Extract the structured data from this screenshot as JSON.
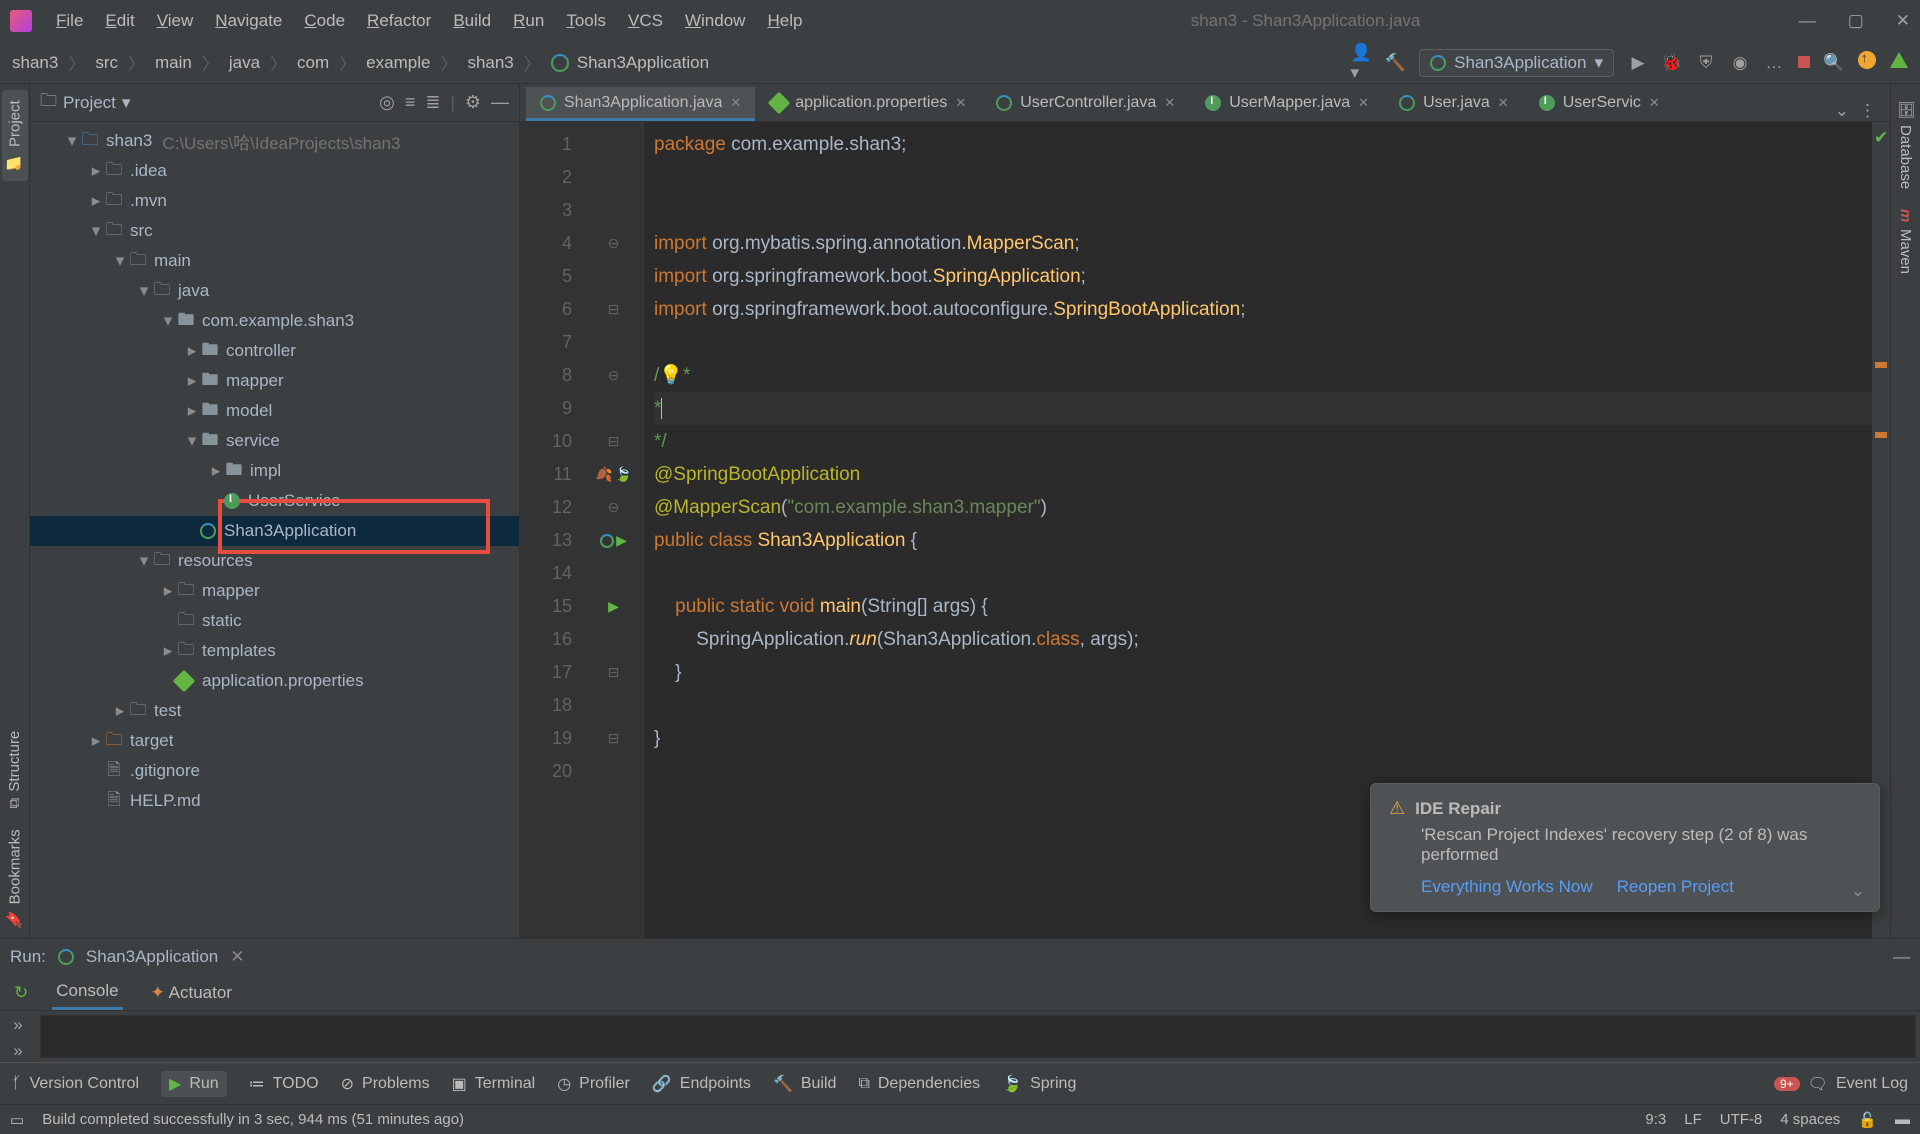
{
  "titlebar": {
    "menus": [
      "File",
      "Edit",
      "View",
      "Navigate",
      "Code",
      "Refactor",
      "Build",
      "Run",
      "Tools",
      "VCS",
      "Window",
      "Help"
    ],
    "title": "shan3 - Shan3Application.java"
  },
  "breadcrumb": [
    "shan3",
    "src",
    "main",
    "java",
    "com",
    "example",
    "shan3",
    "Shan3Application"
  ],
  "runconfig": "Shan3Application",
  "project": {
    "title": "Project",
    "root": {
      "name": "shan3",
      "path": "C:\\Users\\哈\\IdeaProjects\\shan3"
    },
    "tree": [
      {
        "d": 1,
        "arrow": "▾",
        "type": "module",
        "label": "shan3",
        "dim": "C:\\Users\\哈\\IdeaProjects\\shan3"
      },
      {
        "d": 2,
        "arrow": "▸",
        "type": "folder",
        "label": ".idea"
      },
      {
        "d": 2,
        "arrow": "▸",
        "type": "folder",
        "label": ".mvn"
      },
      {
        "d": 2,
        "arrow": "▾",
        "type": "folder",
        "label": "src"
      },
      {
        "d": 3,
        "arrow": "▾",
        "type": "folder",
        "label": "main"
      },
      {
        "d": 4,
        "arrow": "▾",
        "type": "folder-src",
        "label": "java"
      },
      {
        "d": 5,
        "arrow": "▾",
        "type": "pkg",
        "label": "com.example.shan3"
      },
      {
        "d": 6,
        "arrow": "▸",
        "type": "pkg",
        "label": "controller"
      },
      {
        "d": 6,
        "arrow": "▸",
        "type": "pkg",
        "label": "mapper"
      },
      {
        "d": 6,
        "arrow": "▸",
        "type": "pkg",
        "label": "model"
      },
      {
        "d": 6,
        "arrow": "▾",
        "type": "pkg",
        "label": "service"
      },
      {
        "d": 7,
        "arrow": "▸",
        "type": "pkg",
        "label": "impl"
      },
      {
        "d": 7,
        "arrow": "",
        "type": "interface",
        "label": "UserService",
        "strike": true
      },
      {
        "d": 6,
        "arrow": "",
        "type": "class",
        "label": "Shan3Application",
        "selected": true
      },
      {
        "d": 4,
        "arrow": "▾",
        "type": "folder-res",
        "label": "resources"
      },
      {
        "d": 5,
        "arrow": "▸",
        "type": "folder",
        "label": "mapper"
      },
      {
        "d": 5,
        "arrow": "",
        "type": "folder",
        "label": "static"
      },
      {
        "d": 5,
        "arrow": "▸",
        "type": "folder",
        "label": "templates"
      },
      {
        "d": 5,
        "arrow": "",
        "type": "prop",
        "label": "application.properties"
      },
      {
        "d": 3,
        "arrow": "▸",
        "type": "folder-test",
        "label": "test"
      },
      {
        "d": 2,
        "arrow": "▸",
        "type": "folder-orange",
        "label": "target"
      },
      {
        "d": 2,
        "arrow": "",
        "type": "file",
        "label": ".gitignore"
      },
      {
        "d": 2,
        "arrow": "",
        "type": "file-md",
        "label": "HELP.md"
      }
    ]
  },
  "tabs": [
    {
      "label": "Shan3Application.java",
      "kind": "class",
      "active": true
    },
    {
      "label": "application.properties",
      "kind": "prop"
    },
    {
      "label": "UserController.java",
      "kind": "class"
    },
    {
      "label": "UserMapper.java",
      "kind": "interface"
    },
    {
      "label": "User.java",
      "kind": "class"
    },
    {
      "label": "UserServic",
      "kind": "interface"
    }
  ],
  "code": {
    "lines": [
      {
        "n": 1,
        "tokens": [
          [
            "kw",
            "package "
          ],
          [
            "cls",
            "com.example.shan3"
          ],
          [
            "cls",
            ";"
          ]
        ]
      },
      {
        "n": 2,
        "tokens": []
      },
      {
        "n": 3,
        "tokens": []
      },
      {
        "n": 4,
        "tokens": [
          [
            "kw",
            "import "
          ],
          [
            "cls",
            "org.mybatis.spring.annotation."
          ],
          [
            "id",
            "MapperScan"
          ],
          [
            "cls",
            ";"
          ]
        ],
        "gut": "⊖"
      },
      {
        "n": 5,
        "tokens": [
          [
            "kw",
            "import "
          ],
          [
            "cls",
            "org.springframework.boot."
          ],
          [
            "id",
            "SpringApplication"
          ],
          [
            "cls",
            ";"
          ]
        ]
      },
      {
        "n": 6,
        "tokens": [
          [
            "kw",
            "import "
          ],
          [
            "cls",
            "org.springframework.boot.autoconfigure."
          ],
          [
            "id",
            "SpringBootApplication"
          ],
          [
            "cls",
            ";"
          ]
        ],
        "gut": "⊟"
      },
      {
        "n": 7,
        "tokens": []
      },
      {
        "n": 8,
        "tokens": [
          [
            "cmt",
            "/"
          ],
          [
            "bulb",
            "💡"
          ],
          [
            "cmt",
            "*"
          ]
        ],
        "gut": "⊖"
      },
      {
        "n": 9,
        "tokens": [
          [
            "cmt",
            "*"
          ],
          [
            "caret",
            ""
          ]
        ],
        "current": true
      },
      {
        "n": 10,
        "tokens": [
          [
            "cmt",
            "*/"
          ]
        ],
        "gut": "⊟"
      },
      {
        "n": 11,
        "tokens": [
          [
            "ann",
            "@SpringBootApplication"
          ]
        ],
        "gut": "⊖",
        "mark": "leaf"
      },
      {
        "n": 12,
        "tokens": [
          [
            "ann",
            "@MapperScan"
          ],
          [
            "cls",
            "("
          ],
          [
            "str",
            "\"com.example.shan3.mapper\""
          ],
          [
            "cls",
            ")"
          ]
        ],
        "gut": "⊖"
      },
      {
        "n": 13,
        "tokens": [
          [
            "kw",
            "public class "
          ],
          [
            "id",
            "Shan3Application"
          ],
          [
            "cls",
            " {"
          ]
        ],
        "mark": "run"
      },
      {
        "n": 14,
        "tokens": []
      },
      {
        "n": 15,
        "tokens": [
          [
            "pad",
            "    "
          ],
          [
            "kw",
            "public static "
          ],
          [
            "kw",
            "void "
          ],
          [
            "id",
            "main"
          ],
          [
            "cls",
            "(String[] args) {"
          ]
        ],
        "gut": "⊖",
        "mark": "run-tri"
      },
      {
        "n": 16,
        "tokens": [
          [
            "pad",
            "        "
          ],
          [
            "cls",
            "SpringApplication."
          ],
          [
            "static",
            "run"
          ],
          [
            "cls",
            "(Shan3Application."
          ],
          [
            "kw",
            "class"
          ],
          [
            "cls",
            ", args);"
          ]
        ]
      },
      {
        "n": 17,
        "tokens": [
          [
            "pad",
            "    "
          ],
          [
            "cls",
            "}"
          ]
        ],
        "gut": "⊟"
      },
      {
        "n": 18,
        "tokens": []
      },
      {
        "n": 19,
        "tokens": [
          [
            "cls",
            "}"
          ]
        ],
        "gut": "⊟"
      },
      {
        "n": 20,
        "tokens": []
      }
    ]
  },
  "run": {
    "title": "Run:",
    "config": "Shan3Application",
    "subtabs": [
      "Console",
      "Actuator"
    ]
  },
  "bottombar": [
    {
      "icon": "branch",
      "label": "Version Control"
    },
    {
      "icon": "play",
      "label": "Run",
      "active": true
    },
    {
      "icon": "list",
      "label": "TODO"
    },
    {
      "icon": "warn",
      "label": "Problems"
    },
    {
      "icon": "terminal",
      "label": "Terminal"
    },
    {
      "icon": "gauge",
      "label": "Profiler"
    },
    {
      "icon": "link",
      "label": "Endpoints"
    },
    {
      "icon": "hammer",
      "label": "Build"
    },
    {
      "icon": "graph",
      "label": "Dependencies"
    },
    {
      "icon": "leaf",
      "label": "Spring"
    }
  ],
  "bottom_right": {
    "event": "Event Log",
    "badge": "9+"
  },
  "statusbar": {
    "msg": "Build completed successfully in 3 sec, 944 ms (51 minutes ago)",
    "pos": "9:3",
    "sep": "LF",
    "enc": "UTF-8",
    "indent": "4 spaces"
  },
  "left_tabs": [
    "Project",
    "Bookmarks",
    "Structure"
  ],
  "right_tabs": [
    "Database",
    "Maven"
  ],
  "notification": {
    "title": "IDE Repair",
    "msg": "'Rescan Project Indexes' recovery step (2 of 8) was performed",
    "links": [
      "Everything Works Now",
      "Reopen Project"
    ]
  }
}
